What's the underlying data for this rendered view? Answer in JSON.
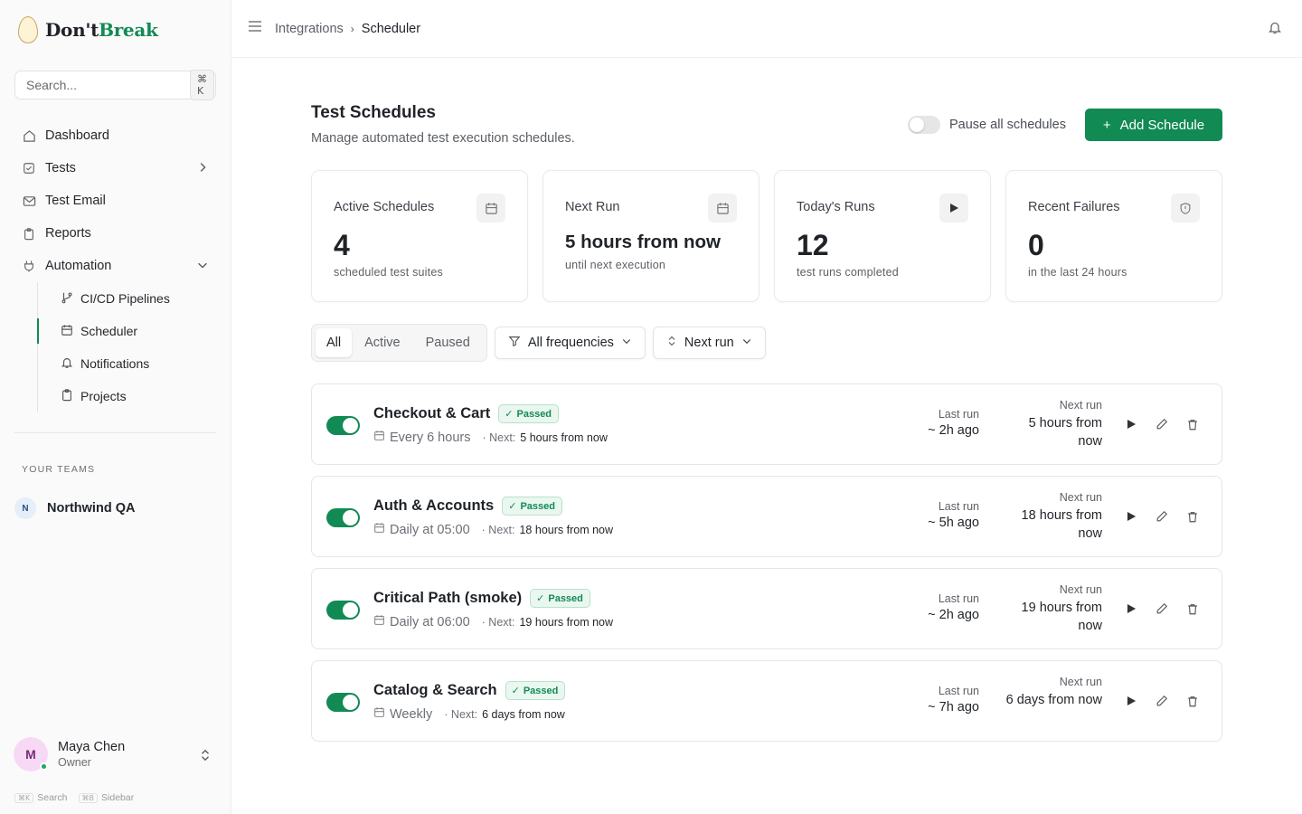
{
  "brand": {
    "name_part1": "Don't",
    "name_part2": "Break"
  },
  "search": {
    "placeholder": "Search...",
    "shortcut": "⌘ K"
  },
  "nav": {
    "dashboard": "Dashboard",
    "tests": "Tests",
    "test_email": "Test Email",
    "reports": "Reports",
    "automation": "Automation",
    "sub": {
      "cicd": "CI/CD Pipelines",
      "scheduler": "Scheduler",
      "notifications": "Notifications",
      "projects": "Projects"
    }
  },
  "teams": {
    "label": "YOUR TEAMS",
    "team_initial": "N",
    "team_name": "Northwind QA"
  },
  "user": {
    "initial": "M",
    "name": "Maya Chen",
    "role": "Owner"
  },
  "shortcuts": {
    "search_key": "⌘K",
    "search_label": "Search",
    "sidebar_key": "⌘B",
    "sidebar_label": "Sidebar"
  },
  "breadcrumb": {
    "parent": "Integrations",
    "current": "Scheduler"
  },
  "page": {
    "title": "Test Schedules",
    "subtitle": "Manage automated test execution schedules.",
    "pause_label": "Pause all schedules",
    "add_label": "Add Schedule"
  },
  "stats": [
    {
      "label": "Active Schedules",
      "value": "4",
      "foot": "scheduled test suites"
    },
    {
      "label": "Next Run",
      "value": "5 hours from now",
      "foot": "until next execution"
    },
    {
      "label": "Today's Runs",
      "value": "12",
      "foot": "test runs completed"
    },
    {
      "label": "Recent Failures",
      "value": "0",
      "foot": "in the last 24 hours"
    }
  ],
  "filters": {
    "tabs": [
      "All",
      "Active",
      "Paused"
    ],
    "selected_tab": "All",
    "frequency": "All frequencies",
    "sort": "Next run"
  },
  "schedules": [
    {
      "name": "Checkout & Cart",
      "status": "Passed",
      "frequency": "Every 6 hours",
      "next_prefix": "· Next:",
      "next_short": "5 hours from now",
      "last_label": "Last run",
      "last_value": "~ 2h ago",
      "next_label": "Next run",
      "next_value": "5 hours from now",
      "enabled": true
    },
    {
      "name": "Auth & Accounts",
      "status": "Passed",
      "frequency": "Daily at 05:00",
      "next_prefix": "· Next:",
      "next_short": "18 hours from now",
      "last_label": "Last run",
      "last_value": "~ 5h ago",
      "next_label": "Next run",
      "next_value": "18 hours from now",
      "enabled": true
    },
    {
      "name": "Critical Path (smoke)",
      "status": "Passed",
      "frequency": "Daily at 06:00",
      "next_prefix": "· Next:",
      "next_short": "19 hours from now",
      "last_label": "Last run",
      "last_value": "~ 2h ago",
      "next_label": "Next run",
      "next_value": "19 hours from now",
      "enabled": true
    },
    {
      "name": "Catalog & Search",
      "status": "Passed",
      "frequency": "Weekly",
      "next_prefix": "· Next:",
      "next_short": "6 days from now",
      "last_label": "Last run",
      "last_value": "~ 7h ago",
      "next_label": "Next run",
      "next_value": "6 days from now",
      "enabled": true
    }
  ],
  "colors": {
    "accent": "#128a54",
    "passed_bg": "#eaf7f0",
    "sidebar_bg": "#fafafa"
  }
}
